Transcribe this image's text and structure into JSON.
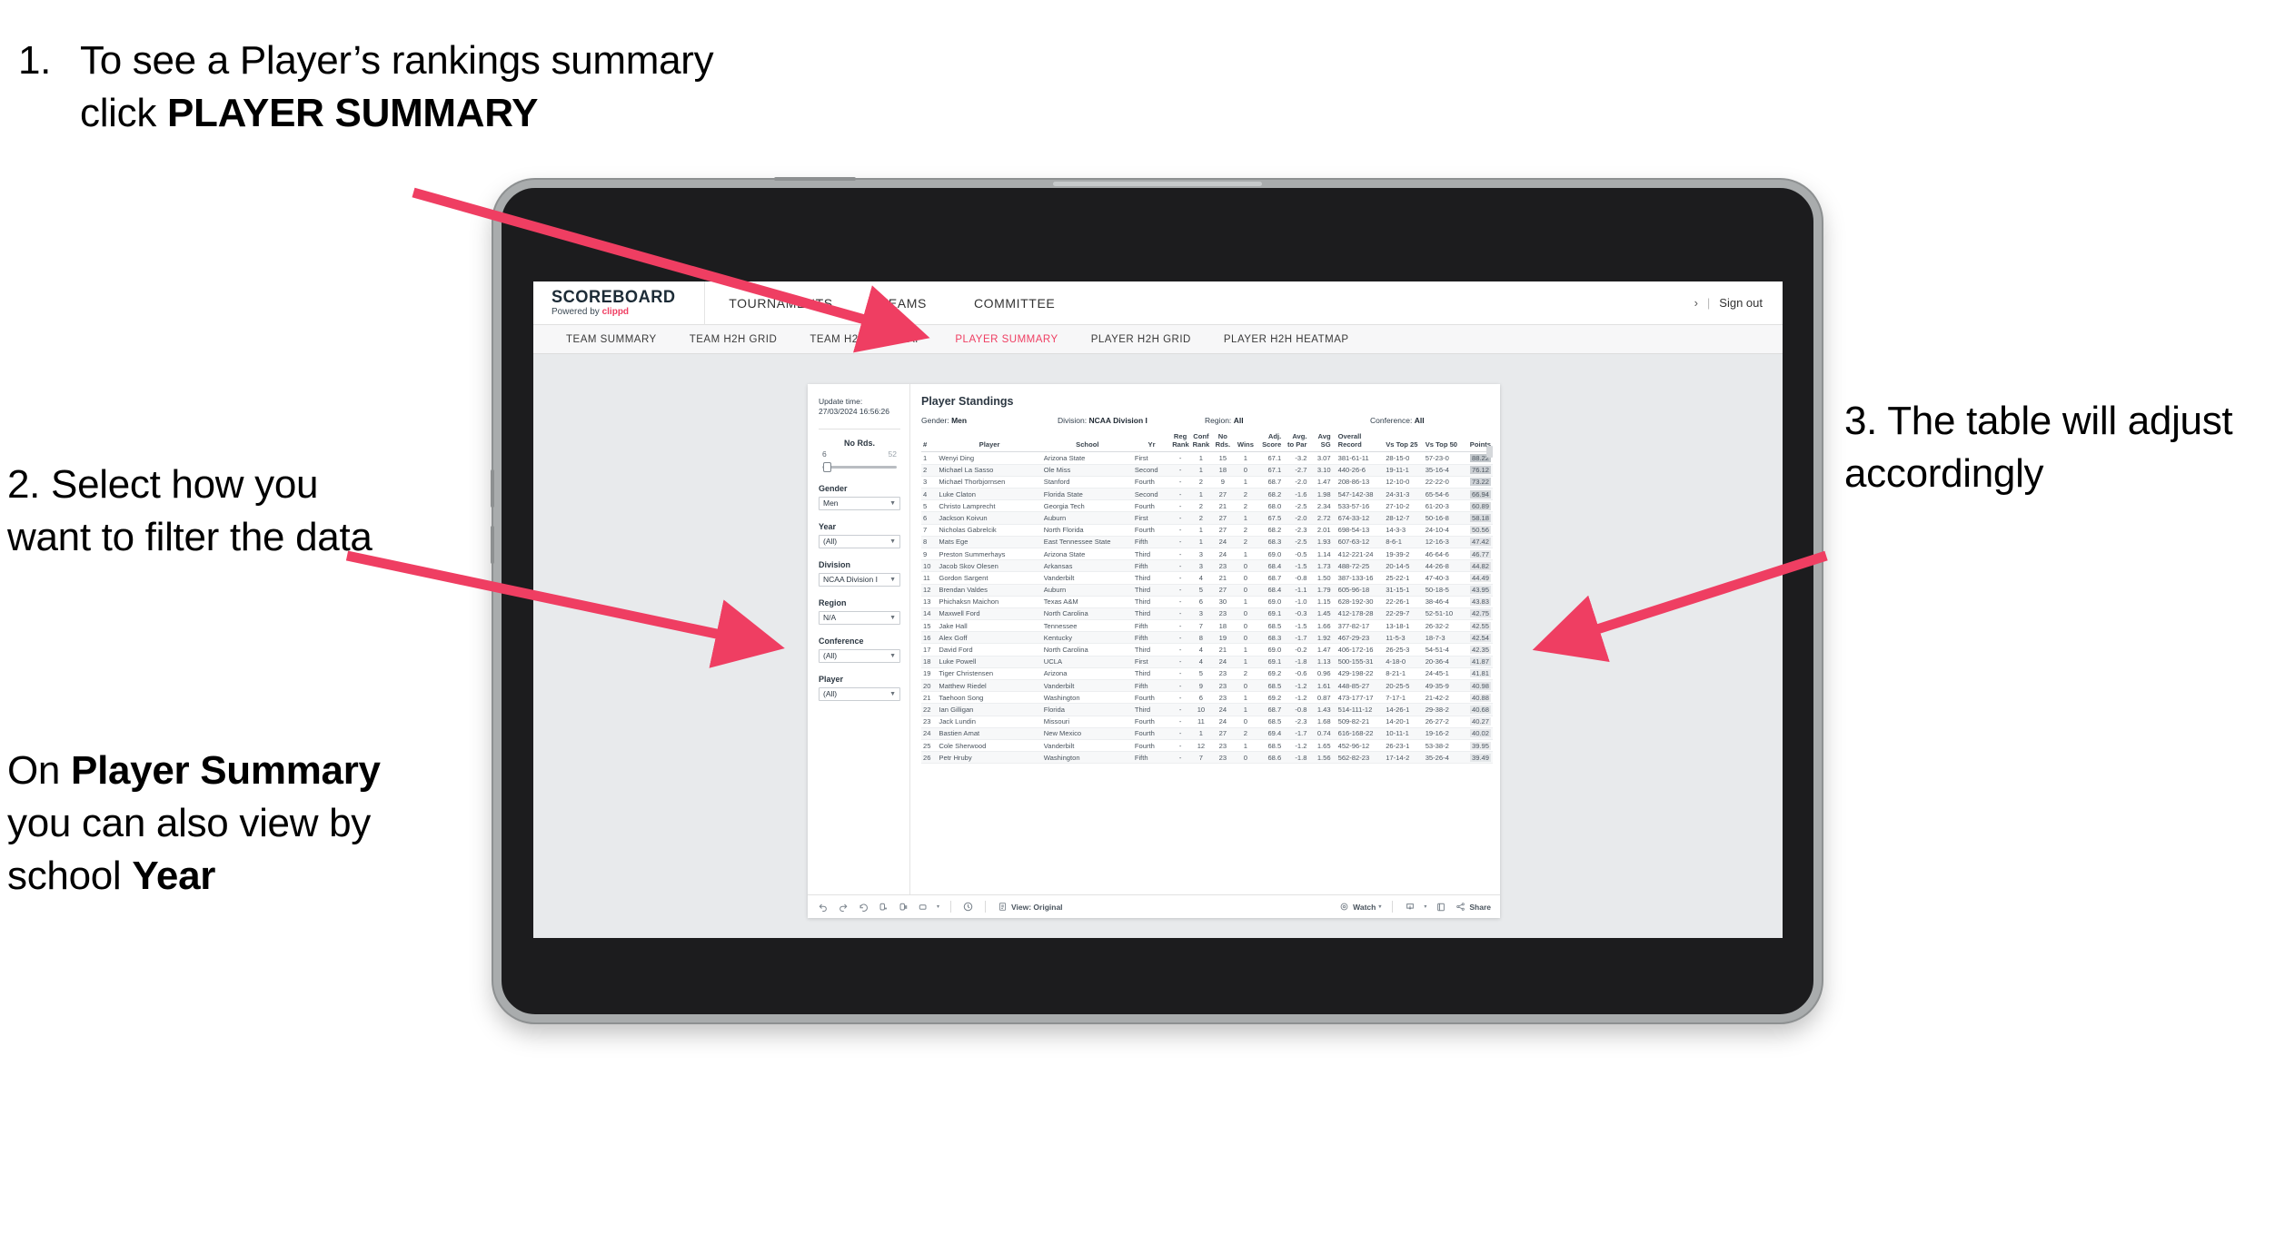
{
  "annotations": {
    "a1": {
      "number": "1.",
      "text_before": "To see a Player’s rankings summary click ",
      "bold": "PLAYER SUMMARY"
    },
    "a2": {
      "text": "2. Select how you want to filter the data"
    },
    "a2b_p1": "On ",
    "a2b_b1": "Player Summary",
    "a2b_p2": " you can also view by school ",
    "a2b_b2": "Year",
    "a3": {
      "text": "3. The table will adjust accordingly"
    }
  },
  "app": {
    "brand": {
      "word": "SCOREBOARD",
      "powered_prefix": "Powered by ",
      "powered_brand": "clippd"
    },
    "top_nav": [
      "TOURNAMENTS",
      "TEAMS",
      "COMMITTEE"
    ],
    "top_right": {
      "chevron": "›",
      "divider": "|",
      "sign_out": "Sign out"
    },
    "sub_nav": [
      {
        "label": "TEAM SUMMARY",
        "active": false
      },
      {
        "label": "TEAM H2H GRID",
        "active": false
      },
      {
        "label": "TEAM H2H HEATMAP",
        "active": false
      },
      {
        "label": "PLAYER SUMMARY",
        "active": true
      },
      {
        "label": "PLAYER H2H GRID",
        "active": false
      },
      {
        "label": "PLAYER H2H HEATMAP",
        "active": false
      }
    ],
    "accent_color": "#ef3e62"
  },
  "filters": {
    "update_label": "Update time:",
    "update_value": "27/03/2024 16:56:26",
    "no_rds": {
      "label": "No Rds.",
      "min": "6",
      "max": "52"
    },
    "controls": [
      {
        "label": "Gender",
        "value": "Men"
      },
      {
        "label": "Year",
        "value": "(All)"
      },
      {
        "label": "Division",
        "value": "NCAA Division I"
      },
      {
        "label": "Region",
        "value": "N/A"
      },
      {
        "label": "Conference",
        "value": "(All)"
      },
      {
        "label": "Player",
        "value": "(All)"
      }
    ]
  },
  "viz": {
    "title": "Player Standings",
    "summary": [
      {
        "key": "Gender:",
        "value": "Men"
      },
      {
        "key": "Division:",
        "value": "NCAA Division I"
      },
      {
        "key": "Region:",
        "value": "All"
      },
      {
        "key": "Conference:",
        "value": "All"
      }
    ],
    "columns": [
      {
        "l1": "#",
        "l2": ""
      },
      {
        "l1": "Player",
        "l2": ""
      },
      {
        "l1": "School",
        "l2": ""
      },
      {
        "l1": "Yr",
        "l2": ""
      },
      {
        "l1": "Reg",
        "l2": "Rank"
      },
      {
        "l1": "Conf",
        "l2": "Rank"
      },
      {
        "l1": "No",
        "l2": "Rds."
      },
      {
        "l1": "Wins",
        "l2": ""
      },
      {
        "l1": "Adj.",
        "l2": "Score"
      },
      {
        "l1": "Avg.",
        "l2": "to Par"
      },
      {
        "l1": "Avg",
        "l2": "SG"
      },
      {
        "l1": "Overall",
        "l2": "Record"
      },
      {
        "l1": "Vs Top 25",
        "l2": ""
      },
      {
        "l1": "Vs Top 50",
        "l2": ""
      },
      {
        "l1": "Points",
        "l2": ""
      }
    ],
    "rows": [
      [
        "1",
        "Wenyi Ding",
        "Arizona State",
        "First",
        "-",
        "1",
        "15",
        "1",
        "67.1",
        "-3.2",
        "3.07",
        "381-61-11",
        "28-15-0",
        "57-23-0",
        "88.22"
      ],
      [
        "2",
        "Michael La Sasso",
        "Ole Miss",
        "Second",
        "-",
        "1",
        "18",
        "0",
        "67.1",
        "-2.7",
        "3.10",
        "440-26-6",
        "19-11-1",
        "35-16-4",
        "76.12"
      ],
      [
        "3",
        "Michael Thorbjornsen",
        "Stanford",
        "Fourth",
        "-",
        "2",
        "9",
        "1",
        "68.7",
        "-2.0",
        "1.47",
        "208-86-13",
        "12-10-0",
        "22-22-0",
        "73.22"
      ],
      [
        "4",
        "Luke Claton",
        "Florida State",
        "Second",
        "-",
        "1",
        "27",
        "2",
        "68.2",
        "-1.6",
        "1.98",
        "547-142-38",
        "24-31-3",
        "65-54-6",
        "66.94"
      ],
      [
        "5",
        "Christo Lamprecht",
        "Georgia Tech",
        "Fourth",
        "-",
        "2",
        "21",
        "2",
        "68.0",
        "-2.5",
        "2.34",
        "533-57-16",
        "27-10-2",
        "61-20-3",
        "60.89"
      ],
      [
        "6",
        "Jackson Koivun",
        "Auburn",
        "First",
        "-",
        "2",
        "27",
        "1",
        "67.5",
        "-2.0",
        "2.72",
        "674-33-12",
        "28-12-7",
        "50-16-8",
        "58.18"
      ],
      [
        "7",
        "Nicholas Gabrelcik",
        "North Florida",
        "Fourth",
        "-",
        "1",
        "27",
        "2",
        "68.2",
        "-2.3",
        "2.01",
        "698-54-13",
        "14-3-3",
        "24-10-4",
        "50.56"
      ],
      [
        "8",
        "Mats Ege",
        "East Tennessee State",
        "Fifth",
        "-",
        "1",
        "24",
        "2",
        "68.3",
        "-2.5",
        "1.93",
        "607-63-12",
        "8-6-1",
        "12-16-3",
        "47.42"
      ],
      [
        "9",
        "Preston Summerhays",
        "Arizona State",
        "Third",
        "-",
        "3",
        "24",
        "1",
        "69.0",
        "-0.5",
        "1.14",
        "412-221-24",
        "19-39-2",
        "46-64-6",
        "46.77"
      ],
      [
        "10",
        "Jacob Skov Olesen",
        "Arkansas",
        "Fifth",
        "-",
        "3",
        "23",
        "0",
        "68.4",
        "-1.5",
        "1.73",
        "488-72-25",
        "20-14-5",
        "44-26-8",
        "44.82"
      ],
      [
        "11",
        "Gordon Sargent",
        "Vanderbilt",
        "Third",
        "-",
        "4",
        "21",
        "0",
        "68.7",
        "-0.8",
        "1.50",
        "387-133-16",
        "25-22-1",
        "47-40-3",
        "44.49"
      ],
      [
        "12",
        "Brendan Valdes",
        "Auburn",
        "Third",
        "-",
        "5",
        "27",
        "0",
        "68.4",
        "-1.1",
        "1.79",
        "605-96-18",
        "31-15-1",
        "50-18-5",
        "43.95"
      ],
      [
        "13",
        "Phichaksn Maichon",
        "Texas A&M",
        "Third",
        "-",
        "6",
        "30",
        "1",
        "69.0",
        "-1.0",
        "1.15",
        "628-192-30",
        "22-26-1",
        "38-46-4",
        "43.83"
      ],
      [
        "14",
        "Maxwell Ford",
        "North Carolina",
        "Third",
        "-",
        "3",
        "23",
        "0",
        "69.1",
        "-0.3",
        "1.45",
        "412-178-28",
        "22-29-7",
        "52-51-10",
        "42.75"
      ],
      [
        "15",
        "Jake Hall",
        "Tennessee",
        "Fifth",
        "-",
        "7",
        "18",
        "0",
        "68.5",
        "-1.5",
        "1.66",
        "377-82-17",
        "13-18-1",
        "26-32-2",
        "42.55"
      ],
      [
        "16",
        "Alex Goff",
        "Kentucky",
        "Fifth",
        "-",
        "8",
        "19",
        "0",
        "68.3",
        "-1.7",
        "1.92",
        "467-29-23",
        "11-5-3",
        "18-7-3",
        "42.54"
      ],
      [
        "17",
        "David Ford",
        "North Carolina",
        "Third",
        "-",
        "4",
        "21",
        "1",
        "69.0",
        "-0.2",
        "1.47",
        "406-172-16",
        "26-25-3",
        "54-51-4",
        "42.35"
      ],
      [
        "18",
        "Luke Powell",
        "UCLA",
        "First",
        "-",
        "4",
        "24",
        "1",
        "69.1",
        "-1.8",
        "1.13",
        "500-155-31",
        "4-18-0",
        "20-36-4",
        "41.87"
      ],
      [
        "19",
        "Tiger Christensen",
        "Arizona",
        "Third",
        "-",
        "5",
        "23",
        "2",
        "69.2",
        "-0.6",
        "0.96",
        "429-198-22",
        "8-21-1",
        "24-45-1",
        "41.81"
      ],
      [
        "20",
        "Matthew Riedel",
        "Vanderbilt",
        "Fifth",
        "-",
        "9",
        "23",
        "0",
        "68.5",
        "-1.2",
        "1.61",
        "448-85-27",
        "20-25-5",
        "49-35-9",
        "40.98"
      ],
      [
        "21",
        "Taehoon Song",
        "Washington",
        "Fourth",
        "-",
        "6",
        "23",
        "1",
        "69.2",
        "-1.2",
        "0.87",
        "473-177-17",
        "7-17-1",
        "21-42-2",
        "40.88"
      ],
      [
        "22",
        "Ian Gilligan",
        "Florida",
        "Third",
        "-",
        "10",
        "24",
        "1",
        "68.7",
        "-0.8",
        "1.43",
        "514-111-12",
        "14-26-1",
        "29-38-2",
        "40.68"
      ],
      [
        "23",
        "Jack Lundin",
        "Missouri",
        "Fourth",
        "-",
        "11",
        "24",
        "0",
        "68.5",
        "-2.3",
        "1.68",
        "509-82-21",
        "14-20-1",
        "26-27-2",
        "40.27"
      ],
      [
        "24",
        "Bastien Amat",
        "New Mexico",
        "Fourth",
        "-",
        "1",
        "27",
        "2",
        "69.4",
        "-1.7",
        "0.74",
        "616-168-22",
        "10-11-1",
        "19-16-2",
        "40.02"
      ],
      [
        "25",
        "Cole Sherwood",
        "Vanderbilt",
        "Fourth",
        "-",
        "12",
        "23",
        "1",
        "68.5",
        "-1.2",
        "1.65",
        "452-96-12",
        "26-23-1",
        "53-38-2",
        "39.95"
      ],
      [
        "26",
        "Petr Hruby",
        "Washington",
        "Fifth",
        "-",
        "7",
        "23",
        "0",
        "68.6",
        "-1.8",
        "1.56",
        "562-82-23",
        "17-14-2",
        "35-26-4",
        "39.49"
      ]
    ]
  },
  "toolbar": {
    "left_icons": [
      "undo-icon",
      "redo-icon",
      "revert-icon",
      "refresh-icon",
      "pause-icon",
      "device-layout-icon"
    ],
    "caret": "▾",
    "view_label": "View: Original",
    "watch_label": "Watch",
    "share_label": "Share"
  }
}
